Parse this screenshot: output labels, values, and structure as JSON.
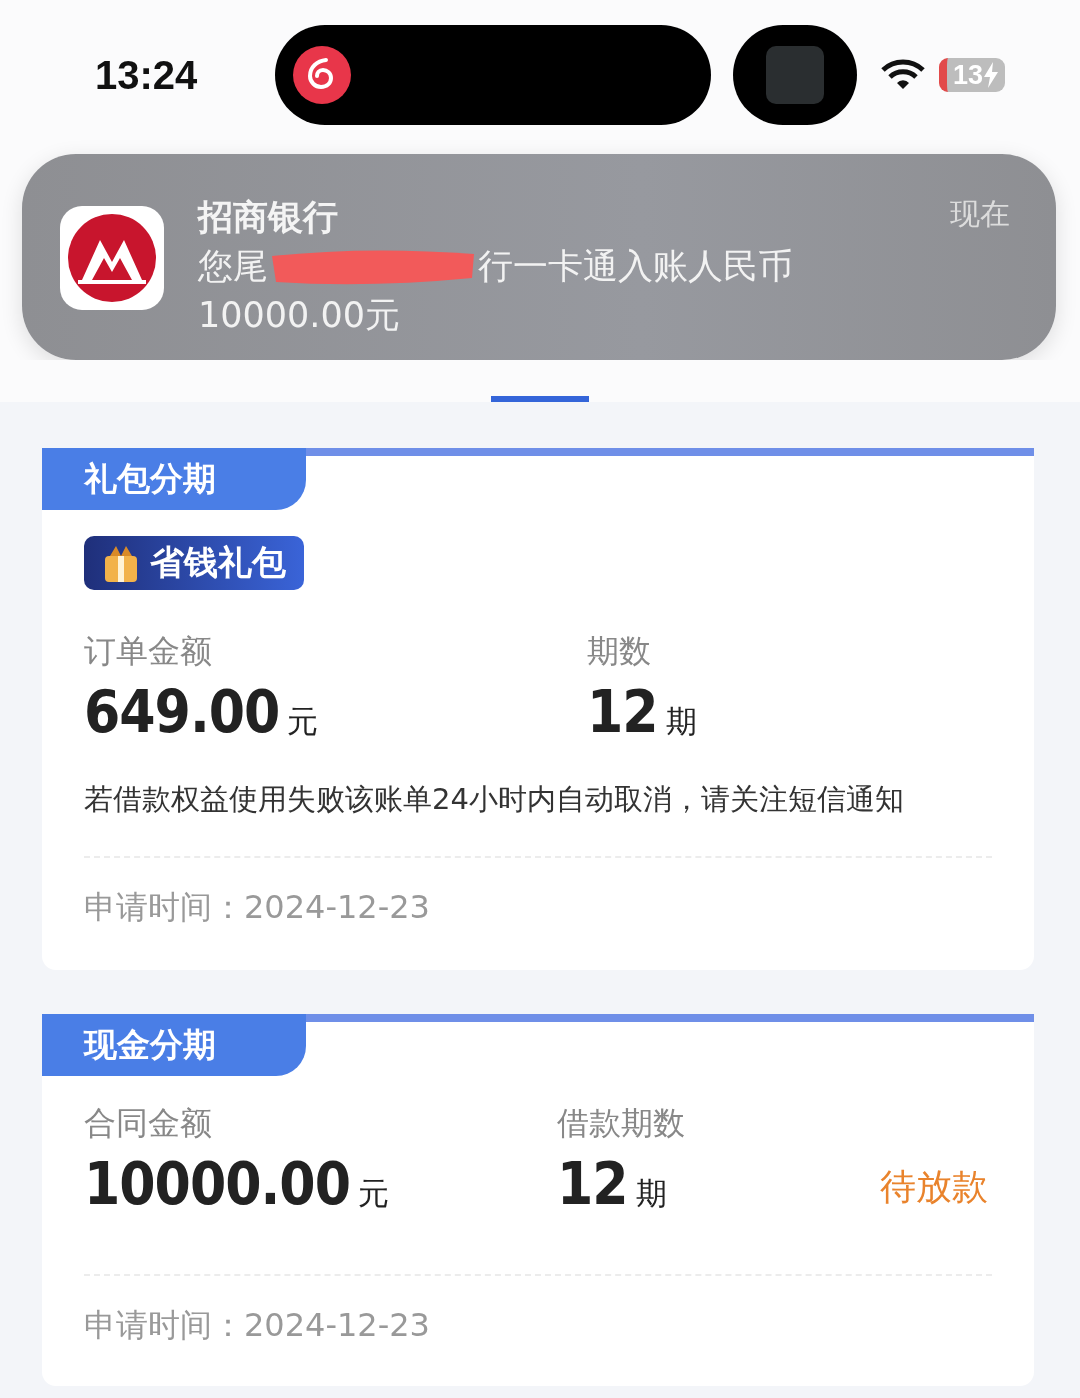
{
  "status_bar": {
    "time": "13:24",
    "battery": "13"
  },
  "notification": {
    "app": "招商银行",
    "time": "现在",
    "message_start": "您尾",
    "message_end": "行一卡通入账人民币",
    "message_amount": "10000.00元",
    "redacted": true
  },
  "cards": [
    {
      "tag": "礼包分期",
      "badge": "省钱礼包",
      "fields": [
        {
          "label": "订单金额",
          "value": "649.00",
          "unit": "元"
        },
        {
          "label": "期数",
          "value": "12",
          "unit": "期"
        }
      ],
      "note": "若借款权益使用失败该账单24小时内自动取消，请关注短信通知",
      "date": "申请时间：2024-12-23"
    },
    {
      "tag": "现金分期",
      "fields": [
        {
          "label": "合同金额",
          "value": "10000.00",
          "unit": "元"
        },
        {
          "label": "借款期数",
          "value": "12",
          "unit": "期"
        }
      ],
      "status": "待放款",
      "date": "申请时间：2024-12-23"
    }
  ]
}
